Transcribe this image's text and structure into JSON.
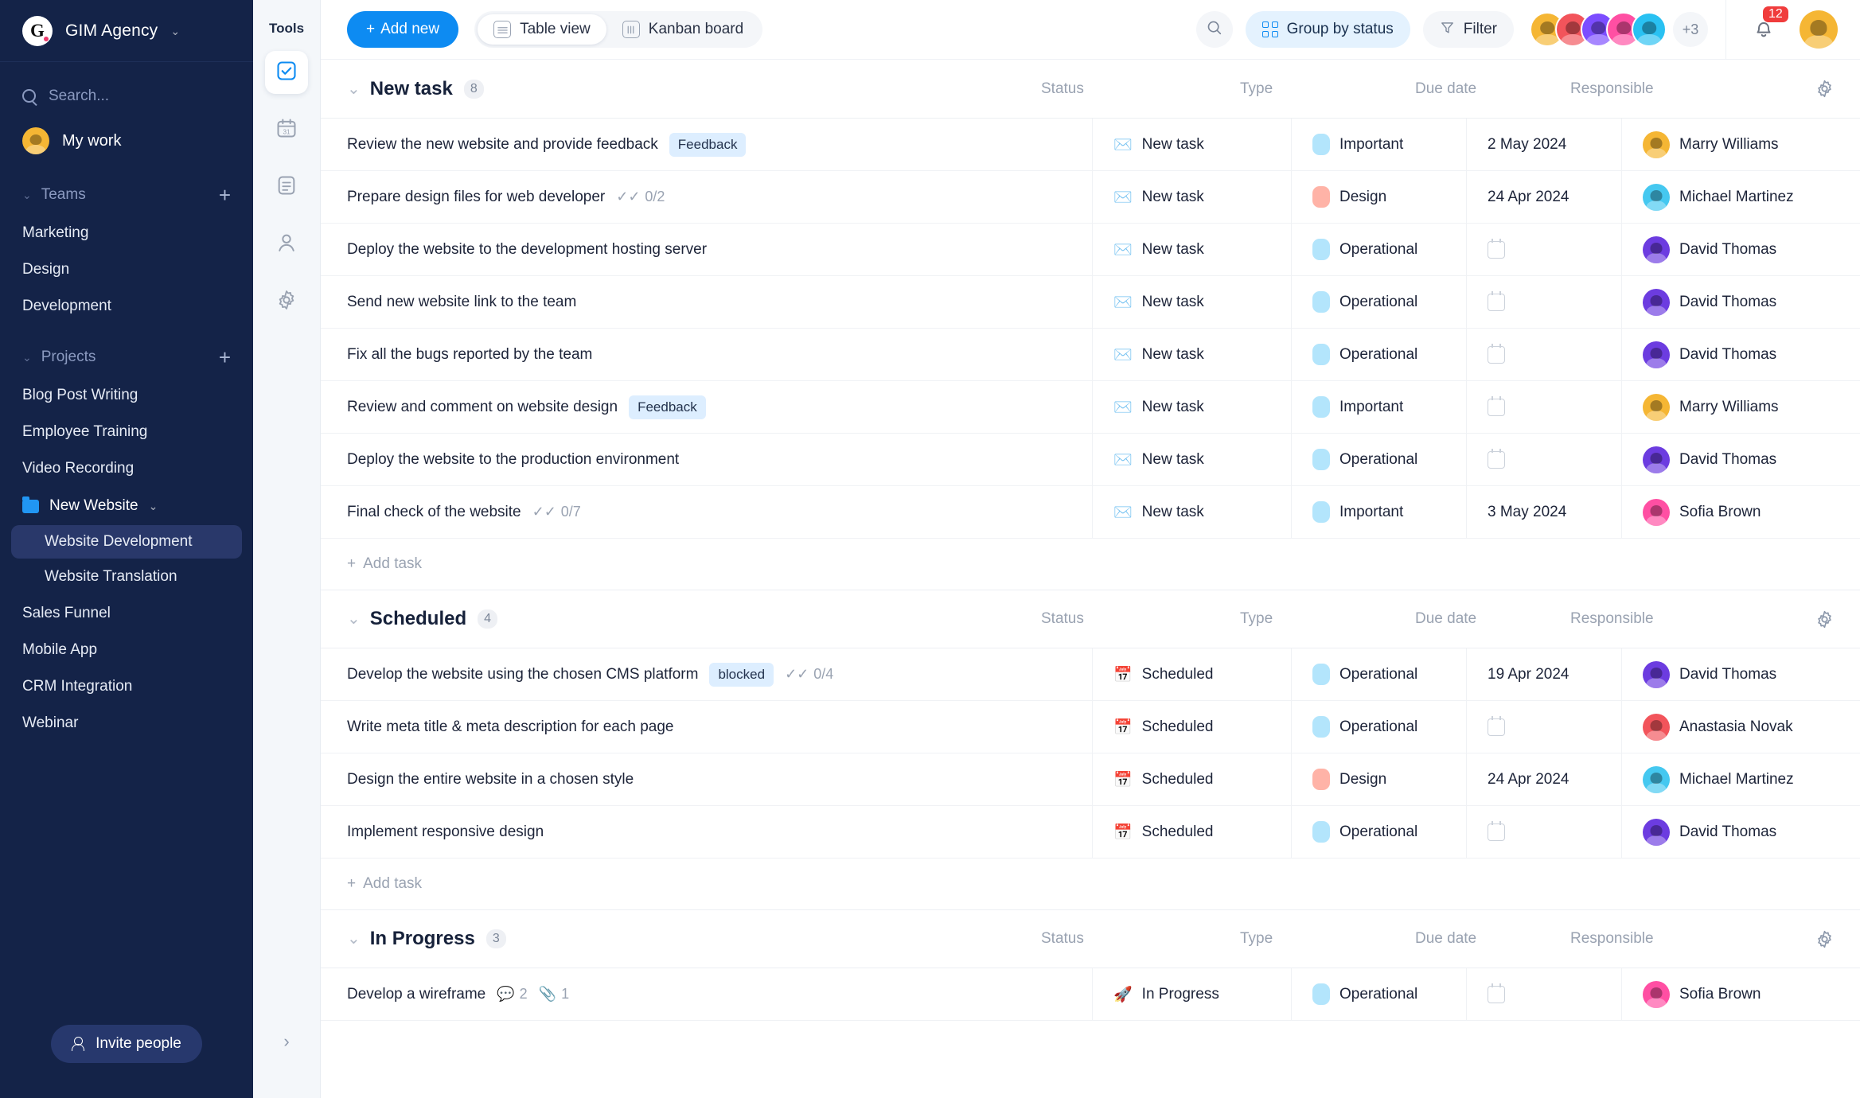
{
  "sidebar": {
    "brand": {
      "logo_letter": "G",
      "name": "GIM Agency",
      "chevron": "⌄"
    },
    "search": {
      "placeholder": "Search...",
      "icon": "search-icon"
    },
    "my_work": {
      "label": "My work",
      "avatar_color": "#f5b634"
    },
    "teams": {
      "label": "Teams",
      "add": "+",
      "items": [
        "Marketing",
        "Design",
        "Development"
      ]
    },
    "projects": {
      "label": "Projects",
      "add": "+",
      "items": [
        "Blog Post Writing",
        "Employee Training",
        "Video Recording"
      ],
      "folder": {
        "label": "New Website",
        "chevron": "⌄",
        "color": "#2196f3"
      },
      "folder_children": [
        "Website Development",
        "Website Translation"
      ],
      "active_child": "Website Development",
      "items_after": [
        "Sales Funnel",
        "Mobile App",
        "CRM Integration",
        "Webinar"
      ]
    },
    "invite": {
      "label": "Invite people",
      "icon": "person-add-icon"
    }
  },
  "tools": {
    "title": "Tools",
    "items": [
      {
        "name": "tasks-icon",
        "selected": true
      },
      {
        "name": "calendar-icon",
        "selected": false,
        "day": "31"
      },
      {
        "name": "notes-icon",
        "selected": false
      },
      {
        "name": "contacts-icon",
        "selected": false
      },
      {
        "name": "settings-icon",
        "selected": false
      }
    ],
    "expand": "›"
  },
  "toolbar": {
    "add_new": "Add new",
    "add_new_plus": "+",
    "views": [
      {
        "label": "Table view",
        "icon": "table-view-icon",
        "active": true
      },
      {
        "label": "Kanban board",
        "icon": "kanban-board-icon",
        "active": false
      }
    ],
    "search_icon": "search-icon",
    "group_by": "Group by status",
    "filter": "Filter",
    "avatars": [
      "#f5b634",
      "#f2545b",
      "#7c4dff",
      "#ff4fa3",
      "#29c1f2"
    ],
    "avatar_overflow": "+3",
    "notifications": "12",
    "user_avatar_color": "#f5b634"
  },
  "columns": {
    "status": "Status",
    "type": "Type",
    "due_date": "Due date",
    "responsible": "Responsible",
    "gear": "gear-icon"
  },
  "add_task_label": "Add task",
  "add_task_plus": "+",
  "groups": [
    {
      "title": "New task",
      "count": "8",
      "chevron": "⌄",
      "show_add_task": true,
      "rows": [
        {
          "title": "Review the new website and provide feedback",
          "tag": "Feedback",
          "sub": "",
          "status": "New task",
          "status_icon": "envelope-icon",
          "type": "Important",
          "type_color": "#b3e5fc",
          "due": "2 May 2024",
          "resp": "Marry Williams",
          "resp_color": "#f5b634"
        },
        {
          "title": "Prepare design files for web developer",
          "tag": "",
          "sub": "0/2",
          "status": "New task",
          "status_icon": "envelope-icon",
          "type": "Design",
          "type_color": "#ffb3a7",
          "due": "24 Apr 2024",
          "resp": "Michael Martinez",
          "resp_color": "#45c8f0"
        },
        {
          "title": "Deploy the website to the development hosting server",
          "tag": "",
          "sub": "",
          "status": "New task",
          "status_icon": "envelope-icon",
          "type": "Operational",
          "type_color": "#b3e5fc",
          "due": "",
          "resp": "David Thomas",
          "resp_color": "#6c3ce0"
        },
        {
          "title": "Send new website link to the team",
          "tag": "",
          "sub": "",
          "status": "New task",
          "status_icon": "envelope-icon",
          "type": "Operational",
          "type_color": "#b3e5fc",
          "due": "",
          "resp": "David Thomas",
          "resp_color": "#6c3ce0"
        },
        {
          "title": "Fix all the bugs reported by the team",
          "tag": "",
          "sub": "",
          "status": "New task",
          "status_icon": "envelope-icon",
          "type": "Operational",
          "type_color": "#b3e5fc",
          "due": "",
          "resp": "David Thomas",
          "resp_color": "#6c3ce0"
        },
        {
          "title": "Review and comment on website design",
          "tag": "Feedback",
          "sub": "",
          "status": "New task",
          "status_icon": "envelope-icon",
          "type": "Important",
          "type_color": "#b3e5fc",
          "due": "",
          "resp": "Marry Williams",
          "resp_color": "#f5b634"
        },
        {
          "title": "Deploy the website to the production environment",
          "tag": "",
          "sub": "",
          "status": "New task",
          "status_icon": "envelope-icon",
          "type": "Operational",
          "type_color": "#b3e5fc",
          "due": "",
          "resp": "David Thomas",
          "resp_color": "#6c3ce0"
        },
        {
          "title": "Final check of the website",
          "tag": "",
          "sub": "0/7",
          "status": "New task",
          "status_icon": "envelope-icon",
          "type": "Important",
          "type_color": "#b3e5fc",
          "due": "3 May 2024",
          "resp": "Sofia Brown",
          "resp_color": "#ff4fa3"
        }
      ]
    },
    {
      "title": "Scheduled",
      "count": "4",
      "chevron": "⌄",
      "show_add_task": true,
      "rows": [
        {
          "title": "Develop the website using the chosen CMS platform",
          "tag": "blocked",
          "sub": "0/4",
          "status": "Scheduled",
          "status_icon": "calendar-17-icon",
          "type": "Operational",
          "type_color": "#b3e5fc",
          "due": "19 Apr 2024",
          "resp": "David Thomas",
          "resp_color": "#6c3ce0"
        },
        {
          "title": "Write meta title & meta description for each page",
          "tag": "",
          "sub": "",
          "status": "Scheduled",
          "status_icon": "calendar-17-icon",
          "type": "Operational",
          "type_color": "#b3e5fc",
          "due": "",
          "resp": "Anastasia Novak",
          "resp_color": "#f2545b"
        },
        {
          "title": "Design the entire website in a chosen style",
          "tag": "",
          "sub": "",
          "status": "Scheduled",
          "status_icon": "calendar-17-icon",
          "type": "Design",
          "type_color": "#ffb3a7",
          "due": "24 Apr 2024",
          "resp": "Michael Martinez",
          "resp_color": "#45c8f0"
        },
        {
          "title": "Implement responsive design",
          "tag": "",
          "sub": "",
          "status": "Scheduled",
          "status_icon": "calendar-17-icon",
          "type": "Operational",
          "type_color": "#b3e5fc",
          "due": "",
          "resp": "David Thomas",
          "resp_color": "#6c3ce0"
        }
      ]
    },
    {
      "title": "In Progress",
      "count": "3",
      "chevron": "⌄",
      "show_add_task": false,
      "rows": [
        {
          "title": "Develop a wireframe",
          "tag": "",
          "sub": "",
          "comments": "2",
          "attachments": "1",
          "status": "In Progress",
          "status_icon": "rocket-icon",
          "type": "Operational",
          "type_color": "#b3e5fc",
          "due": "",
          "resp": "Sofia Brown",
          "resp_color": "#ff4fa3"
        }
      ]
    }
  ]
}
